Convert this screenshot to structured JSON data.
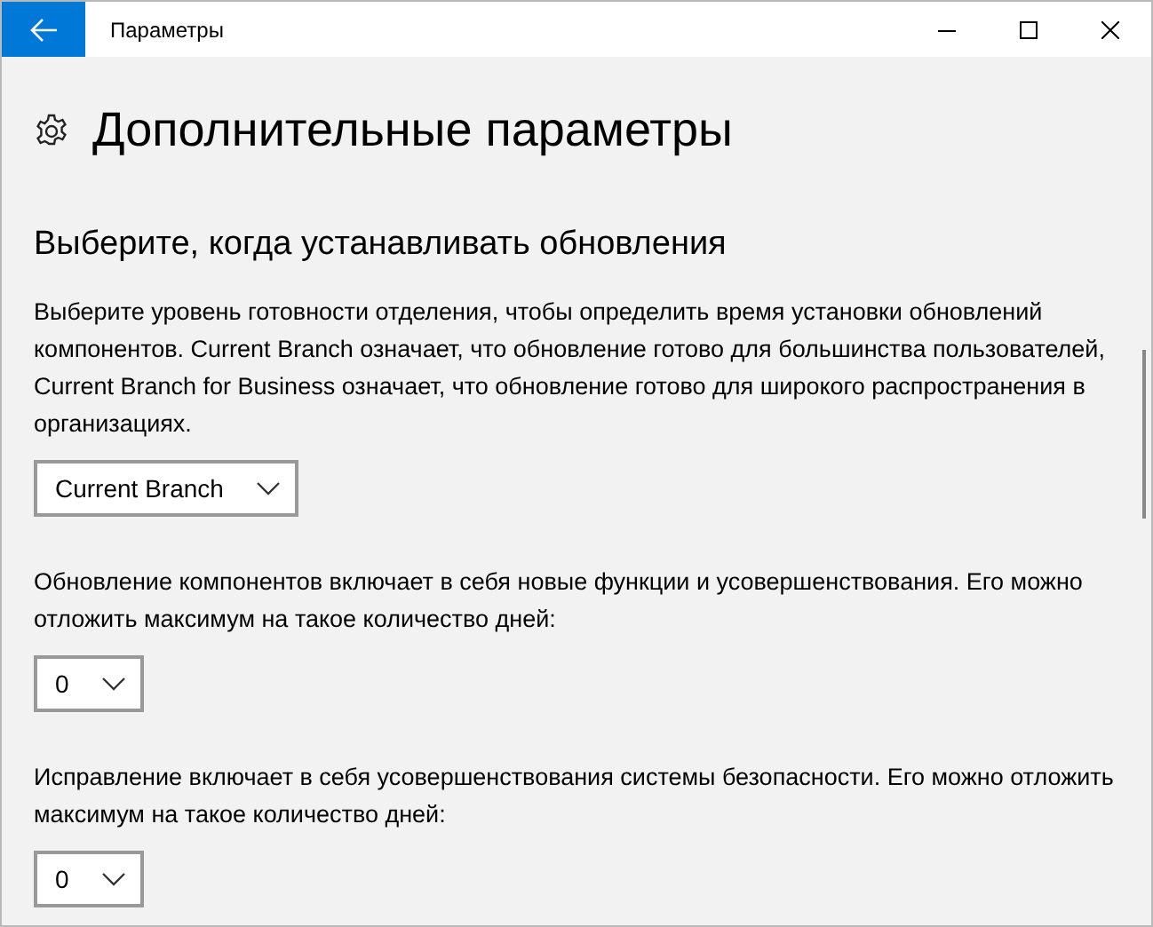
{
  "window": {
    "title": "Параметры"
  },
  "page": {
    "title": "Дополнительные параметры"
  },
  "section": {
    "title": "Выберите, когда устанавливать обновления"
  },
  "settings": [
    {
      "description": "Выберите уровень готовности отделения, чтобы определить время установки обновлений компонентов. Current Branch означает, что обновление готово для большинства пользователей, Current Branch for Business означает, что обновление готово для широкого распространения в организациях.",
      "dropdown": {
        "value": "Current Branch"
      }
    },
    {
      "description": "Обновление компонентов включает в себя новые функции и усовершенствования. Его можно отложить максимум на такое количество дней:",
      "dropdown": {
        "value": "0"
      }
    },
    {
      "description": "Исправление включает в себя усовершенствования системы безопасности. Его можно отложить максимум на такое количество дней:",
      "dropdown": {
        "value": "0"
      }
    }
  ]
}
